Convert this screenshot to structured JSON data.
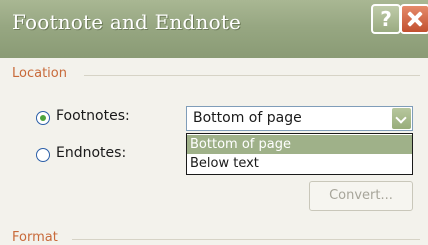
{
  "window": {
    "title": "Footnote and Endnote",
    "help_glyph": "?"
  },
  "location": {
    "group_label": "Location",
    "footnotes_label": "Footnotes:",
    "footnotes_selected": true,
    "endnotes_label": "Endnotes:",
    "endnotes_selected": false,
    "combo_value": "Bottom of page",
    "dropdown_options": [
      "Bottom of page",
      "Below text"
    ],
    "dropdown_highlighted_index": 0,
    "convert_label": "Convert..."
  },
  "format": {
    "group_label": "Format"
  },
  "colors": {
    "titlebar": "#97a782",
    "group_label": "#c86a3a",
    "radio_dot": "#4da43d",
    "close_button": "#c2502f",
    "selection": "#9fb189"
  },
  "icons": {
    "help": "help-icon",
    "close": "close-icon",
    "dropdown_arrow": "chevron-down-icon"
  }
}
